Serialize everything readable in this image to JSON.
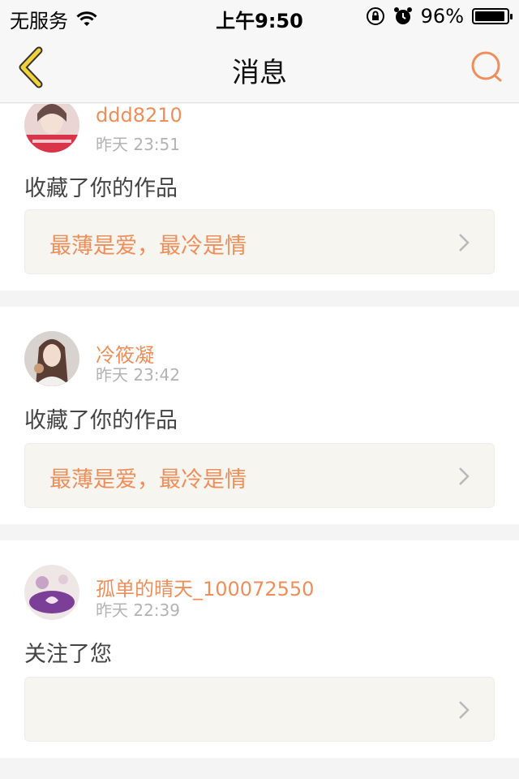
{
  "status_bar": {
    "carrier": "无服务",
    "time": "上午9:50",
    "battery": "96%",
    "battery_level": 0.96
  },
  "nav": {
    "title": "消息",
    "back_icon": "chevron-left-icon",
    "search_icon": "search-icon"
  },
  "colors": {
    "accent": "#ef8e5a",
    "back_icon": "#f2d23a",
    "card_bg": "#ffffff",
    "work_bg": "#f6f5ef"
  },
  "messages": [
    {
      "username": "ddd8210",
      "time": "昨天 23:51",
      "action": "收藏了你的作品",
      "work_title": "最薄是爱，最冷是情"
    },
    {
      "username": "冷筱凝",
      "time": "昨天 23:42",
      "action": "收藏了你的作品",
      "work_title": "最薄是爱，最冷是情"
    },
    {
      "username": "孤单的晴天_100072550",
      "time": "昨天 22:39",
      "action": "关注了您",
      "work_title": ""
    }
  ]
}
